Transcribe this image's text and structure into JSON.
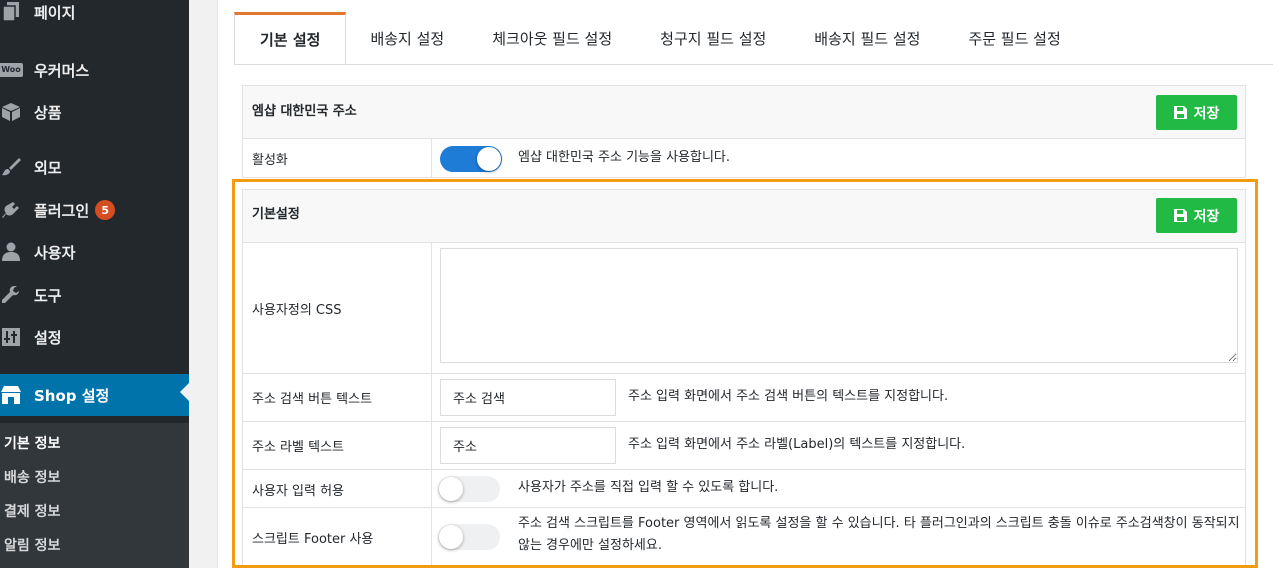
{
  "sidebar": {
    "items": [
      {
        "label": "페이지",
        "icon": "pages-icon"
      },
      {
        "label": "우커머스",
        "icon": "woo-icon",
        "icon_text": "Woo"
      },
      {
        "label": "상품",
        "icon": "box-icon"
      },
      {
        "label": "외모",
        "icon": "brush-icon"
      },
      {
        "label": "플러그인",
        "icon": "plugin-icon",
        "badge": "5"
      },
      {
        "label": "사용자",
        "icon": "user-icon"
      },
      {
        "label": "도구",
        "icon": "wrench-icon"
      },
      {
        "label": "설정",
        "icon": "settings-icon"
      },
      {
        "label": "Shop 설정",
        "icon": "shop-icon",
        "active": true
      }
    ],
    "submenu": [
      {
        "label": "기본 정보",
        "current": true
      },
      {
        "label": "배송 정보"
      },
      {
        "label": "결제 정보"
      },
      {
        "label": "알림 정보"
      }
    ]
  },
  "tabs": [
    {
      "label": "기본 설정",
      "active": true
    },
    {
      "label": "배송지 설정"
    },
    {
      "label": "체크아웃 필드 설정"
    },
    {
      "label": "청구지 필드 설정"
    },
    {
      "label": "배송지 필드 설정"
    },
    {
      "label": "주문 필드 설정"
    }
  ],
  "section1": {
    "title": "엠샵 대한민국 주소",
    "save_label": "저장",
    "rows": [
      {
        "label": "활성화",
        "toggle": true,
        "description": "엠샵 대한민국 주소 기능을 사용합니다."
      }
    ]
  },
  "section2": {
    "title": "기본설정",
    "save_label": "저장",
    "css_label": "사용자정의 CSS",
    "css_value": "",
    "search_button": {
      "label": "주소 검색 버튼 텍스트",
      "value": "주소 검색",
      "description": "주소 입력 화면에서 주소 검색 버튼의 텍스트를 지정합니다."
    },
    "address_label": {
      "label": "주소 라벨 텍스트",
      "value": "주소",
      "description": "주소 입력 화면에서 주소 라벨(Label)의 텍스트를 지정합니다."
    },
    "user_input": {
      "label": "사용자 입력 허용",
      "toggle": false,
      "description": "사용자가 주소를 직접 입력 할 수 있도록 합니다."
    },
    "script_footer": {
      "label": "스크립트 Footer 사용",
      "toggle": false,
      "description": "주소 검색 스크립트를 Footer 영역에서 읽도록 설정을 할 수 있습니다. 타 플러그인과의 스크립트 충돌 이슈로 주소검색창이 동작되지 않는 경우에만 설정하세요."
    }
  },
  "colors": {
    "sidebar_bg": "#23282d",
    "active_menu": "#0073aa",
    "save_button": "#21ba45",
    "toggle_on": "#1e7bd6",
    "highlight": "#f39c12",
    "tab_accent": "#e27730"
  }
}
